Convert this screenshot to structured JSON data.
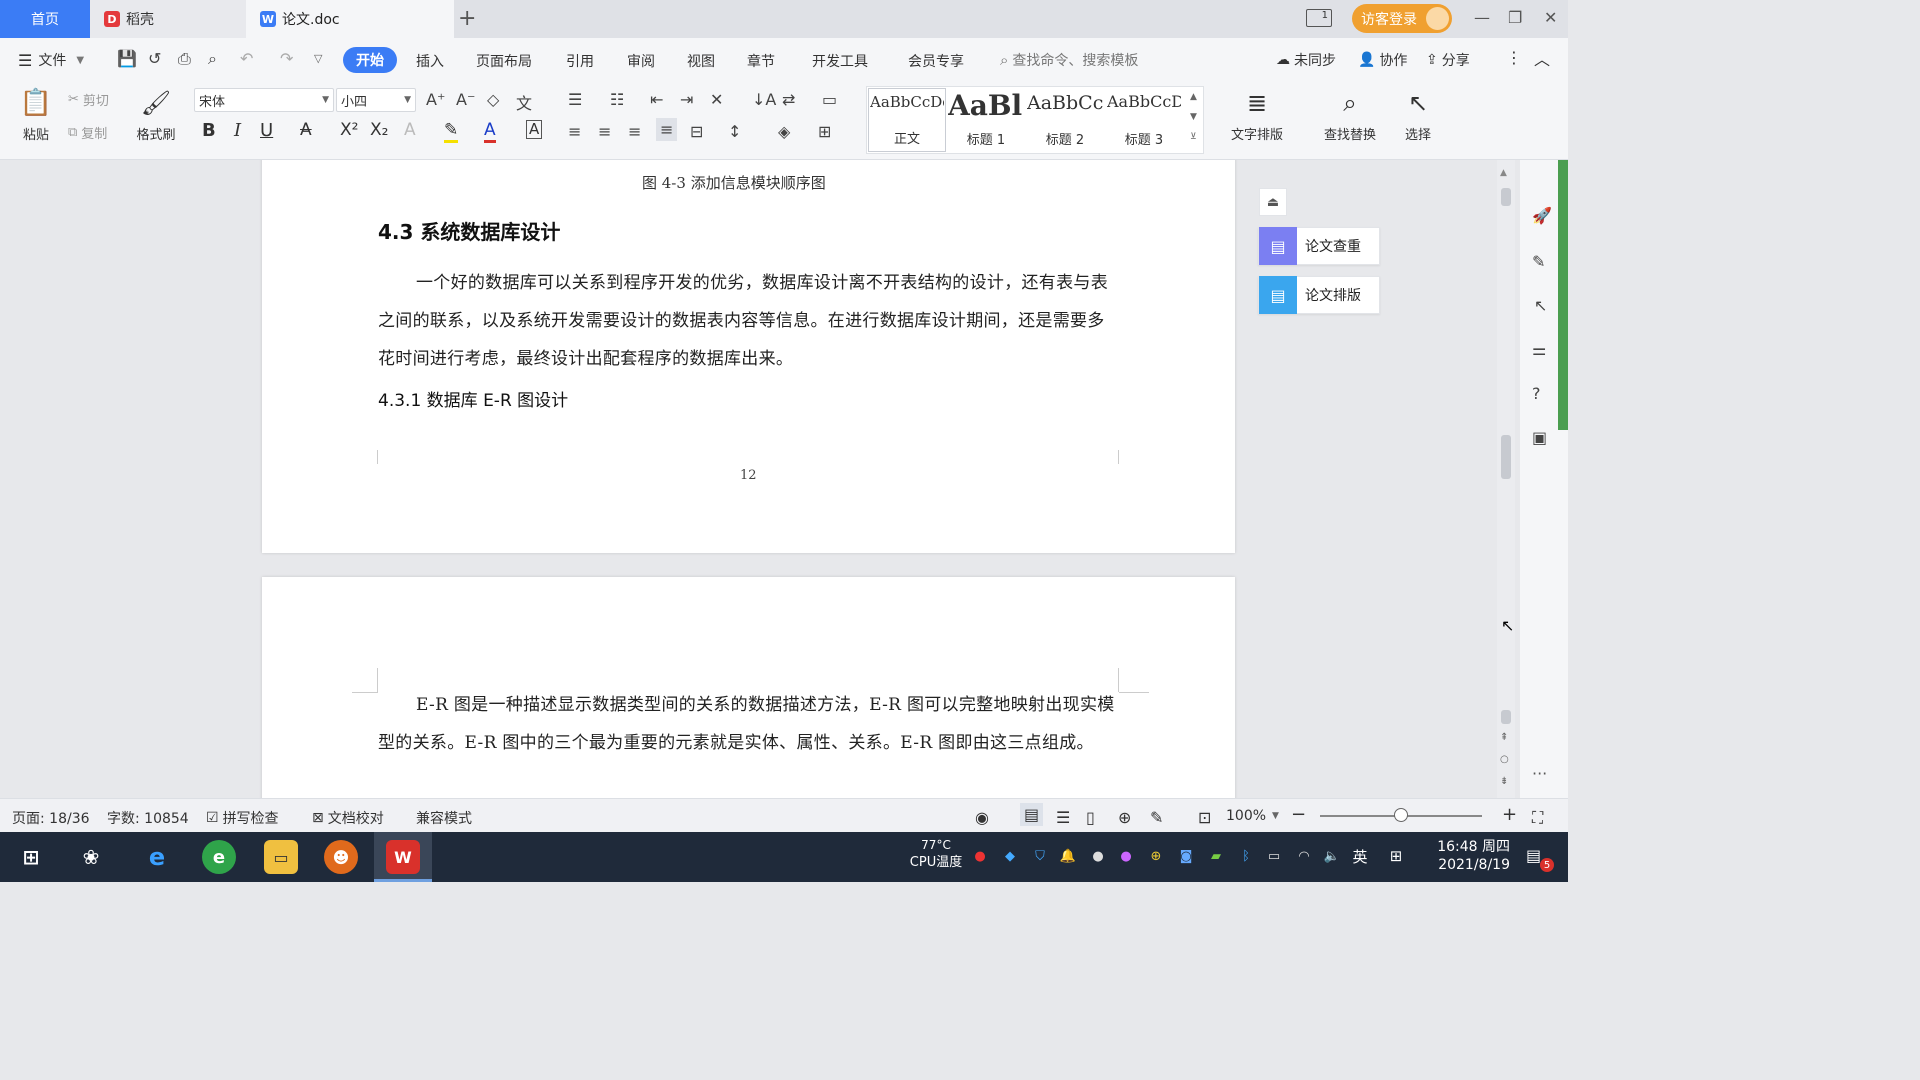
{
  "tabs": {
    "home": "首页",
    "daoke": "稻壳",
    "doc": "论文.doc",
    "add": "+"
  },
  "titlebar": {
    "login": "访客登录",
    "minimize": "—",
    "restore": "❐",
    "close": "✕"
  },
  "menu": {
    "file": "文件",
    "start": "开始",
    "items": [
      "插入",
      "页面布局",
      "引用",
      "审阅",
      "视图",
      "章节",
      "开发工具",
      "会员专享"
    ],
    "search_placeholder": "查找命令、搜索模板",
    "sync": "未同步",
    "collab": "协作",
    "share": "分享"
  },
  "ribbon": {
    "paste": "粘贴",
    "cut": "剪切",
    "copy": "复制",
    "format_painter": "格式刷",
    "font_name": "宋体",
    "font_size": "小四",
    "styles": [
      {
        "preview": "AaBbCcDd",
        "label": "正文"
      },
      {
        "preview": "AaBl",
        "label": "标题 1"
      },
      {
        "preview": "AaBbCcI",
        "label": "标题 2"
      },
      {
        "preview": "AaBbCcDi",
        "label": "标题 3"
      }
    ],
    "text_layout": "文字排版",
    "find_replace": "查找替换",
    "select": "选择"
  },
  "document": {
    "figure_caption": "图 4-3 添加信息模块顺序图",
    "section_title": "4.3 系统数据库设计",
    "paragraph1": "一个好的数据库可以关系到程序开发的优劣，数据库设计离不开表结构的设计，还有表与表之间的联系，以及系统开发需要设计的数据表内容等信息。在进行数据库设计期间，还是需要多花时间进行考虑，最终设计出配套程序的数据库出来。",
    "subsection_title": "4.3.1 数据库 E-R 图设计",
    "page_number": "12",
    "paragraph2": "E-R 图是一种描述显示数据类型间的关系的数据描述方法，E-R 图可以完整地映射出现实模型的关系。E-R 图中的三个最为重要的元素就是实体、属性、关系。E-R 图即由这三点组成。"
  },
  "side_panel": {
    "check": "论文查重",
    "layout": "论文排版"
  },
  "status": {
    "page": "页面: 18/36",
    "words": "字数: 10854",
    "spell": "拼写检查",
    "proof": "文档校对",
    "compat": "兼容模式",
    "zoom": "100%",
    "zoom_value": 0.5
  },
  "taskbar": {
    "cpu_temp": "77°C",
    "cpu_label": "CPU温度",
    "ime": "英",
    "time": "16:48 周四",
    "date": "2021/8/19",
    "notify_count": "5"
  },
  "colors": {
    "accent": "#3b7cf5",
    "login_bg": "#f0a030",
    "wps_red": "#d9312b"
  }
}
